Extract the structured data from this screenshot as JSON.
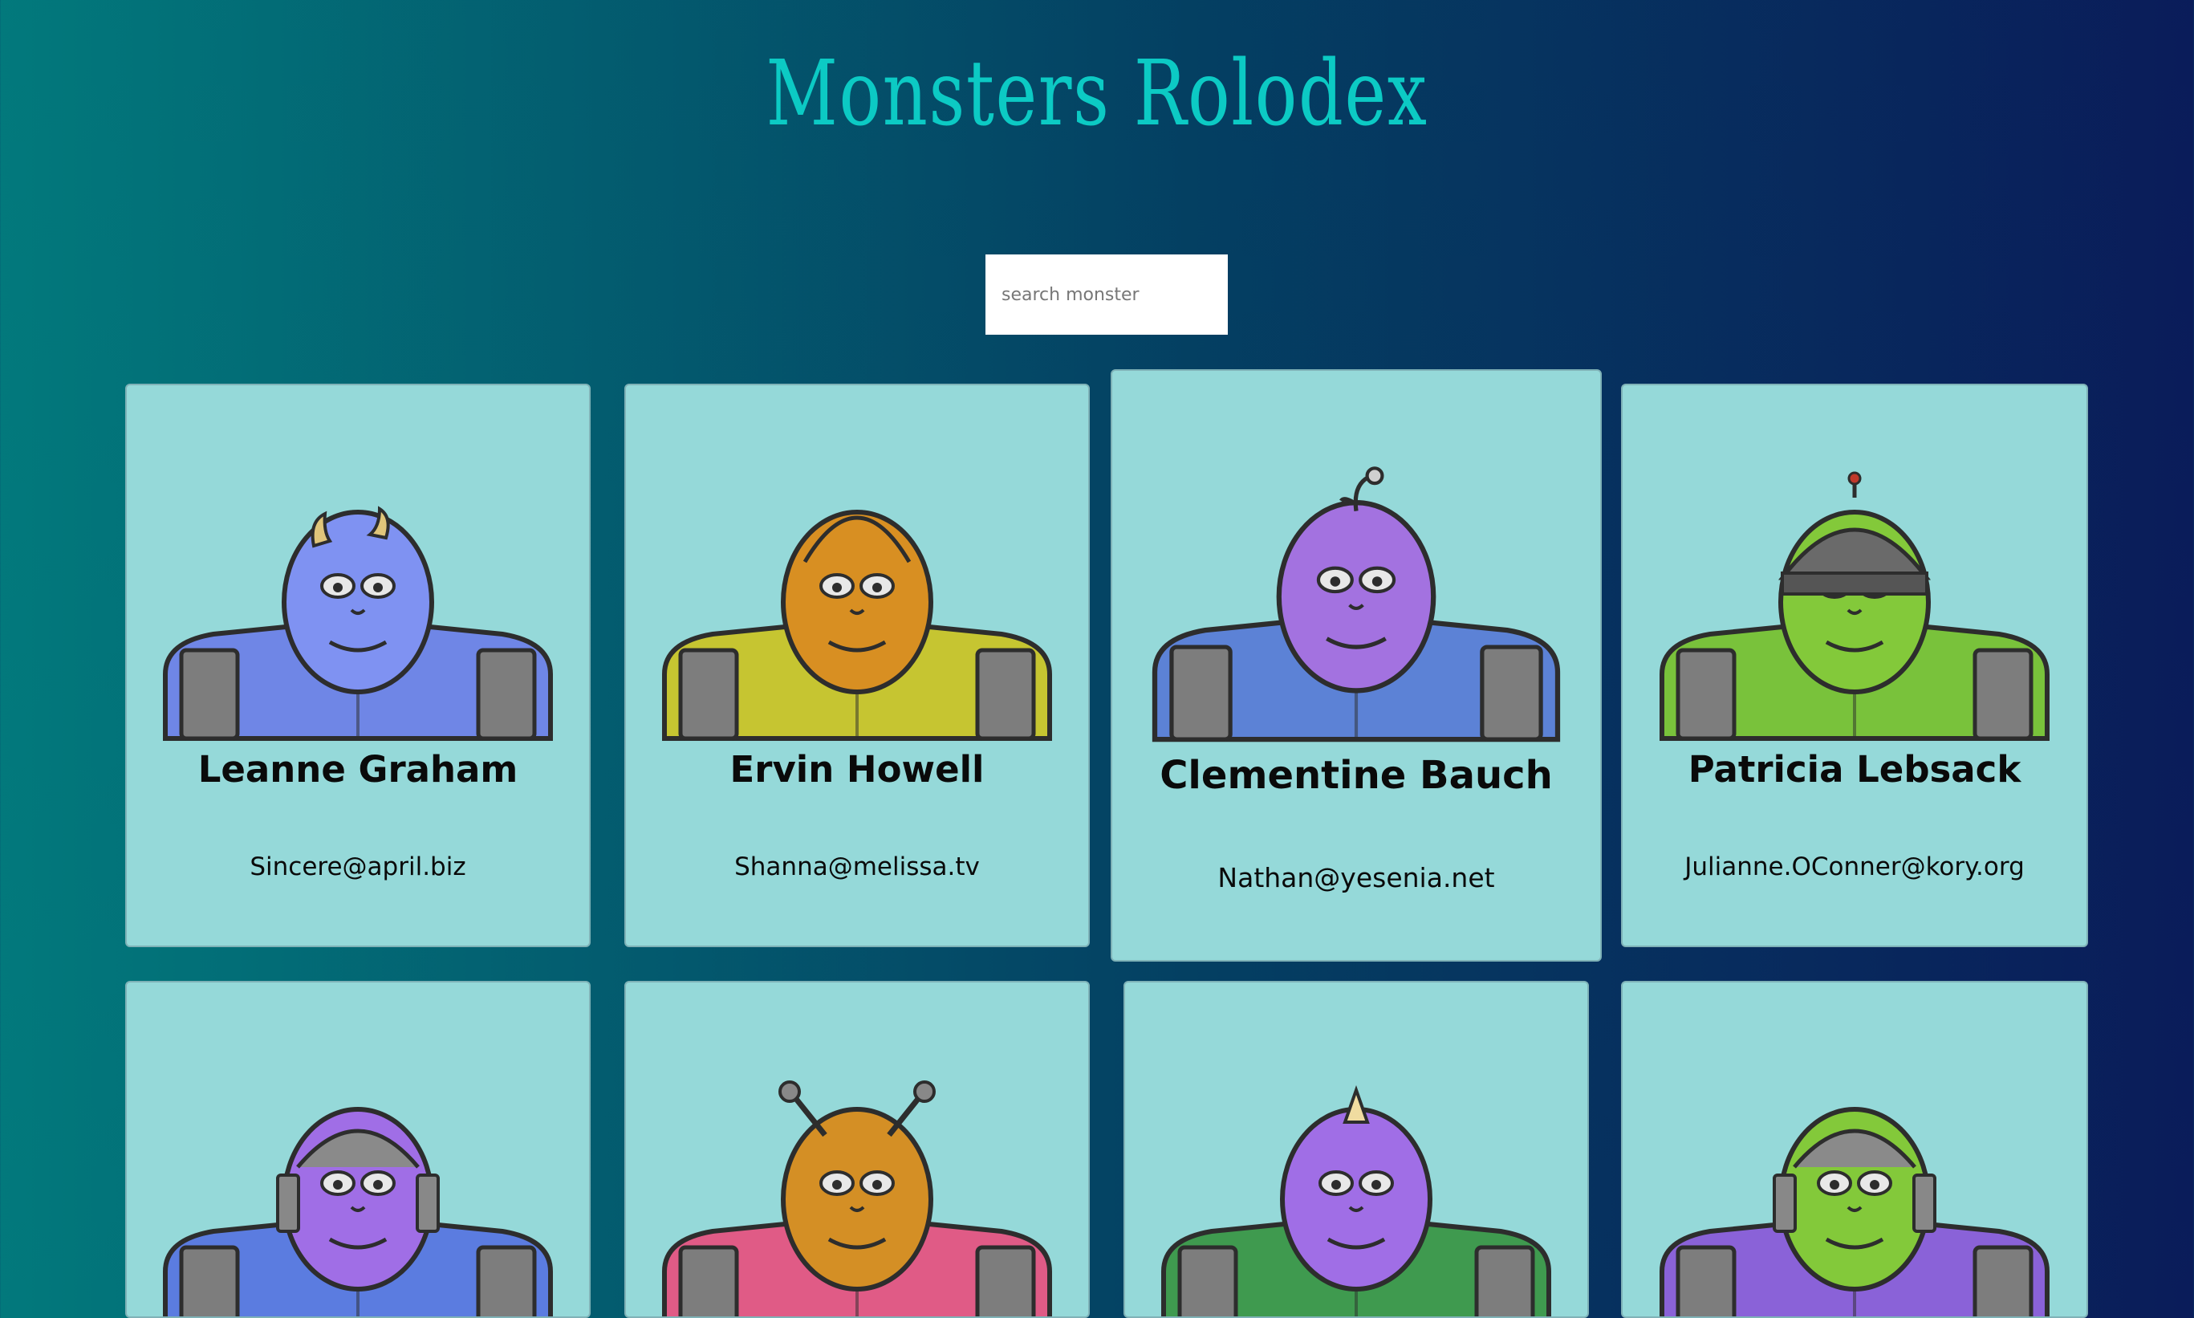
{
  "header": {
    "title": "Monsters Rolodex"
  },
  "search": {
    "placeholder": "search monster"
  },
  "cards": [
    {
      "name": "Leanne Graham",
      "email": "Sincere@april.biz",
      "head_color": "#7f92f2",
      "body_color": "#6f86e6",
      "feature": "horns"
    },
    {
      "name": "Ervin Howell",
      "email": "Shanna@melissa.tv",
      "head_color": "#d88f22",
      "body_color": "#c6c531",
      "feature": "hood"
    },
    {
      "name": "Clementine Bauch",
      "email": "Nathan@yesenia.net",
      "head_color": "#a372e0",
      "body_color": "#5c82d6",
      "feature": "sprout"
    },
    {
      "name": "Patricia Lebsack",
      "email": "Julianne.OConner@kory.org",
      "head_color": "#83c93a",
      "body_color": "#79c23b",
      "feature": "helmet"
    },
    {
      "name": "",
      "email": "",
      "head_color": "#a06ee6",
      "body_color": "#5b7ce0",
      "feature": "robot"
    },
    {
      "name": "",
      "email": "",
      "head_color": "#d48f25",
      "body_color": "#e05b86",
      "feature": "antennae"
    },
    {
      "name": "",
      "email": "",
      "head_color": "#a06ee6",
      "body_color": "#3f9a4f",
      "feature": "horn"
    },
    {
      "name": "",
      "email": "",
      "head_color": "#83c93a",
      "body_color": "#8a62d8",
      "feature": "robot"
    }
  ]
}
